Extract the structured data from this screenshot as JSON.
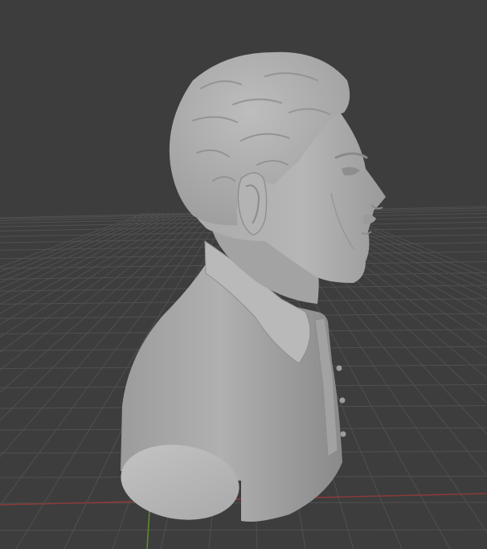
{
  "viewport": {
    "background_color": "#3d3d3d",
    "grid_color": "#505050",
    "x_axis_color": "#8a3a3a",
    "y_axis_color": "#5d8a2e",
    "model_color": "#a6a6a6"
  }
}
